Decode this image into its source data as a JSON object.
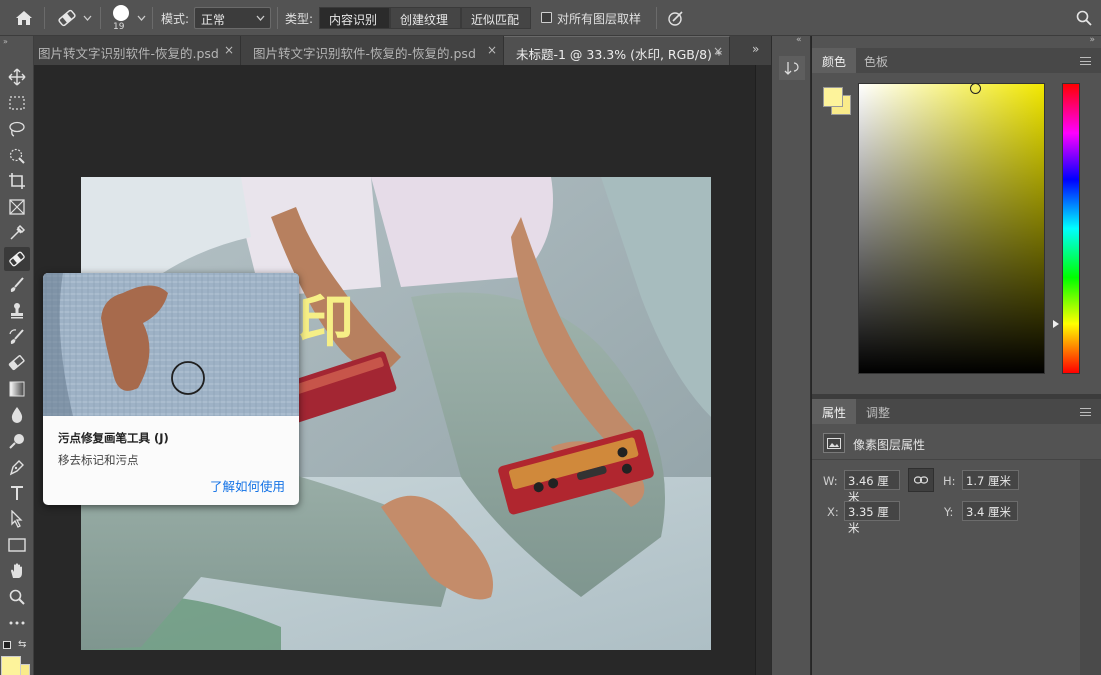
{
  "options_bar": {
    "brush_size": "19",
    "mode_label": "模式:",
    "mode_value": "正常",
    "type_label": "类型:",
    "type_buttons": [
      "内容识别",
      "创建纹理",
      "近似匹配"
    ],
    "sample_all_layers_label": "对所有图层取样"
  },
  "tabs": [
    {
      "label": "图片转文字识别软件-恢复的.psd",
      "close": "×"
    },
    {
      "label": "图片转文字识别软件-恢复的-恢复的.psd",
      "close": "×"
    },
    {
      "label": "未标题-1 @ 33.3% (水印, RGB/8) *",
      "close": "×"
    }
  ],
  "canvas": {
    "watermark_text": "印"
  },
  "tooltip": {
    "title": "污点修复画笔工具 (J)",
    "description": "移去标记和污点",
    "link": "了解如何使用"
  },
  "color_panel": {
    "tabs": [
      "颜色",
      "色板"
    ],
    "foreground": "#fdf39b",
    "background": "#f9eb8a",
    "hue_base": "#f2e800"
  },
  "properties_panel": {
    "tabs": [
      "属性",
      "调整"
    ],
    "header": "像素图层属性",
    "w_label": "W:",
    "w_value": "3.46 厘米",
    "h_label": "H:",
    "h_value": "1.7 厘米",
    "x_label": "X:",
    "x_value": "3.35 厘米",
    "y_label": "Y:",
    "y_value": "3.4 厘米"
  },
  "colors": {
    "ui_dark": "#535353",
    "accent_link": "#1473e6"
  }
}
